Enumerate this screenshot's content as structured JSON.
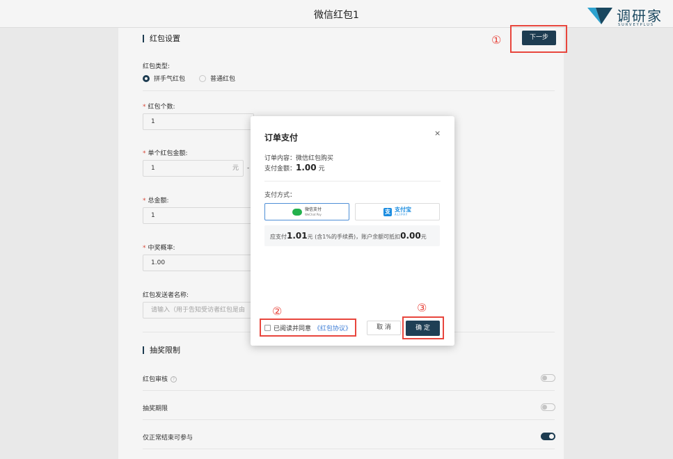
{
  "header": {
    "title": "微信红包1"
  },
  "logo": {
    "name": "调研家",
    "sub": "SURVEYPLUS"
  },
  "settings": {
    "section_title": "红包设置",
    "next_label": "下一步",
    "type_label": "红包类型:",
    "type_options": [
      "拼手气红包",
      "普通红包"
    ],
    "count_label": "红包个数:",
    "count_value": "1",
    "amount_label": "单个红包金额:",
    "amount_value": "1",
    "amount_unit": "元",
    "amount_dash": "-",
    "total_label": "总金额:",
    "total_value": "1",
    "prob_label": "中奖概率:",
    "prob_value": "1.00",
    "sender_label": "红包发送者名称:",
    "sender_placeholder": "请输入（用于告知受访者红包是由"
  },
  "limits": {
    "section_title": "抽奖限制",
    "rows": [
      {
        "label": "红包审核",
        "on": false
      },
      {
        "label": "抽奖期限",
        "on": false
      },
      {
        "label": "仅正常结束可参与",
        "on": true
      }
    ]
  },
  "modal": {
    "title": "订单支付",
    "close": "×",
    "content_label": "订单内容：",
    "content_value": "微信红包购买",
    "amount_label": "支付金额：",
    "amount_value": "1.00",
    "amount_unit": "元",
    "method_label": "支付方式：",
    "wechat_cn": "微信支付",
    "wechat_en": "WeChat Pay",
    "alipay_cn": "支付宝",
    "alipay_en": "ALIPAY",
    "summary_prefix": "应支付",
    "summary_pay": "1.01",
    "summary_mid": "元 (含1%的手续费)，账户余额可抵扣",
    "summary_deduct": "0.00",
    "summary_suffix": "元",
    "agree_text": "已阅读并同意",
    "agree_link": "《红包协议》",
    "cancel_label": "取 消",
    "ok_label": "确 定"
  },
  "annotations": [
    "①",
    "②",
    "③"
  ],
  "colors": {
    "primary": "#1f3f55",
    "annotation": "#e8453c",
    "link": "#3a7bd5",
    "wechat": "#23b14d",
    "alipay": "#1a8ce0"
  }
}
